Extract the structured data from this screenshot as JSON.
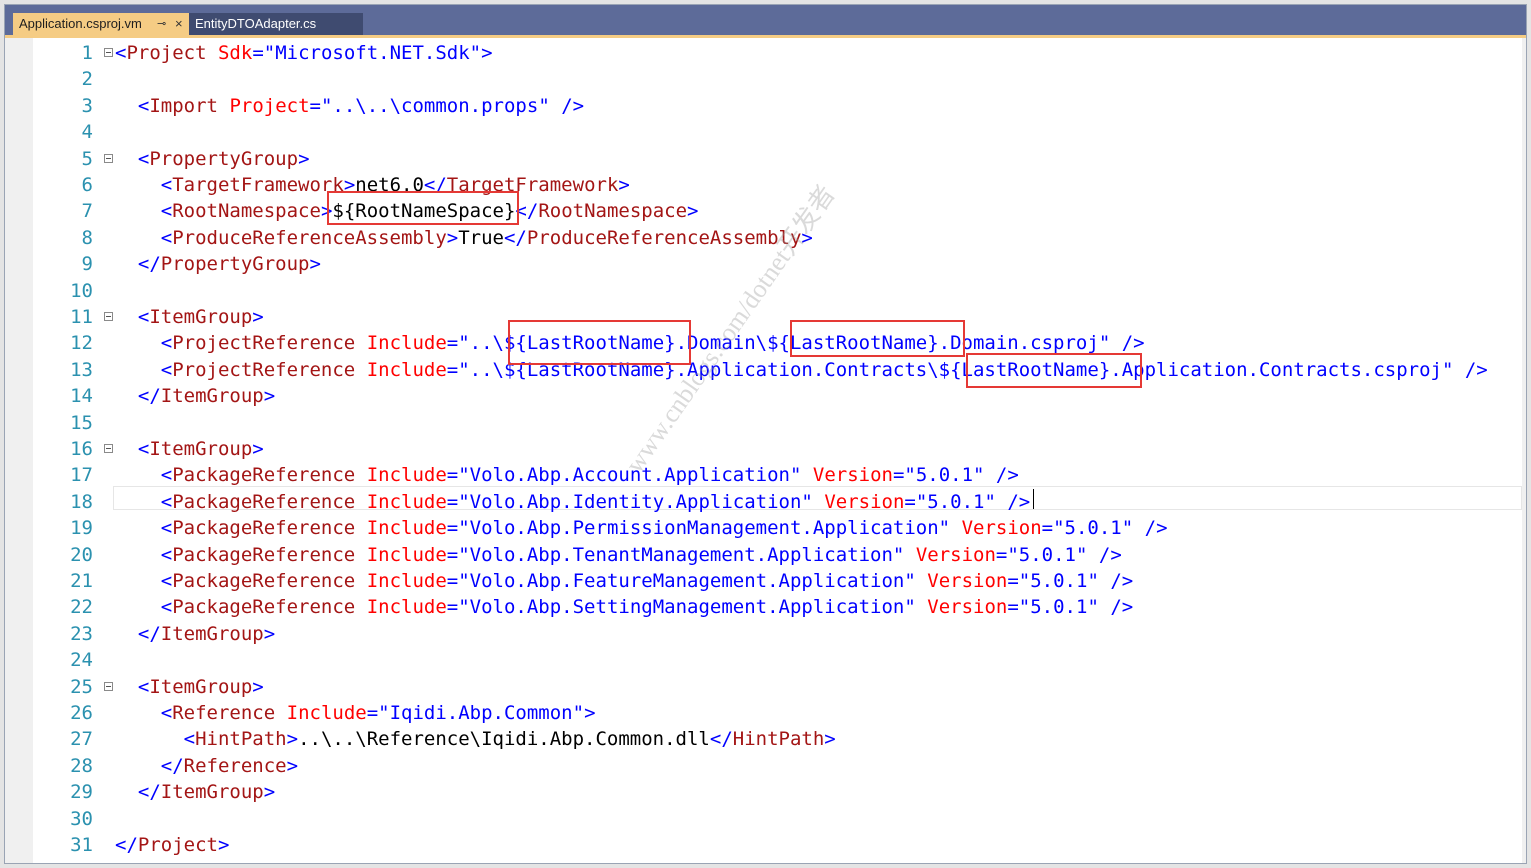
{
  "tabs": [
    {
      "label": "Application.csproj.vm",
      "pin": "⊸",
      "close": "×",
      "active": true
    },
    {
      "label": "EntityDTOAdapter.cs",
      "active": false
    }
  ],
  "watermark": "www.cnblogs.com/dotnet开发者",
  "lines": [
    {
      "n": "1",
      "fold": true,
      "s": [
        [
          "t",
          "<"
        ],
        [
          "e",
          "Project"
        ],
        [
          "x",
          " "
        ],
        [
          "a",
          "Sdk"
        ],
        [
          "t",
          "=\""
        ],
        [
          "v",
          "Microsoft.NET.Sdk"
        ],
        [
          "t",
          "\">"
        ]
      ]
    },
    {
      "n": "2",
      "s": []
    },
    {
      "n": "3",
      "s": [
        [
          "x",
          "  "
        ],
        [
          "t",
          "<"
        ],
        [
          "e",
          "Import"
        ],
        [
          "x",
          " "
        ],
        [
          "a",
          "Project"
        ],
        [
          "t",
          "=\""
        ],
        [
          "v",
          "..\\..\\common.props"
        ],
        [
          "t",
          "\" />"
        ]
      ]
    },
    {
      "n": "4",
      "s": []
    },
    {
      "n": "5",
      "fold": true,
      "s": [
        [
          "x",
          "  "
        ],
        [
          "t",
          "<"
        ],
        [
          "e",
          "PropertyGroup"
        ],
        [
          "t",
          ">"
        ]
      ]
    },
    {
      "n": "6",
      "s": [
        [
          "x",
          "    "
        ],
        [
          "t",
          "<"
        ],
        [
          "e",
          "TargetFramework"
        ],
        [
          "t",
          ">"
        ],
        [
          "x",
          "net6.0"
        ],
        [
          "t",
          "</"
        ],
        [
          "e",
          "TargetFramework"
        ],
        [
          "t",
          ">"
        ]
      ]
    },
    {
      "n": "7",
      "s": [
        [
          "x",
          "    "
        ],
        [
          "t",
          "<"
        ],
        [
          "e",
          "RootNamespace"
        ],
        [
          "t",
          ">"
        ],
        [
          "x",
          "${RootNameSpace}"
        ],
        [
          "t",
          "</"
        ],
        [
          "e",
          "RootNamespace"
        ],
        [
          "t",
          ">"
        ]
      ]
    },
    {
      "n": "8",
      "s": [
        [
          "x",
          "    "
        ],
        [
          "t",
          "<"
        ],
        [
          "e",
          "ProduceReferenceAssembly"
        ],
        [
          "t",
          ">"
        ],
        [
          "x",
          "True"
        ],
        [
          "t",
          "</"
        ],
        [
          "e",
          "ProduceReferenceAssembly"
        ],
        [
          "t",
          ">"
        ]
      ]
    },
    {
      "n": "9",
      "s": [
        [
          "x",
          "  "
        ],
        [
          "t",
          "</"
        ],
        [
          "e",
          "PropertyGroup"
        ],
        [
          "t",
          ">"
        ]
      ]
    },
    {
      "n": "10",
      "s": []
    },
    {
      "n": "11",
      "fold": true,
      "s": [
        [
          "x",
          "  "
        ],
        [
          "t",
          "<"
        ],
        [
          "e",
          "ItemGroup"
        ],
        [
          "t",
          ">"
        ]
      ]
    },
    {
      "n": "12",
      "s": [
        [
          "x",
          "    "
        ],
        [
          "t",
          "<"
        ],
        [
          "e",
          "ProjectReference"
        ],
        [
          "x",
          " "
        ],
        [
          "a",
          "Include"
        ],
        [
          "t",
          "=\""
        ],
        [
          "v",
          "..\\${LastRootName}.Domain\\${LastRootName}.Domain.csproj"
        ],
        [
          "t",
          "\" />"
        ]
      ]
    },
    {
      "n": "13",
      "s": [
        [
          "x",
          "    "
        ],
        [
          "t",
          "<"
        ],
        [
          "e",
          "ProjectReference"
        ],
        [
          "x",
          " "
        ],
        [
          "a",
          "Include"
        ],
        [
          "t",
          "=\""
        ],
        [
          "v",
          "..\\${LastRootName}.Application.Contracts\\${LastRootName}.Application.Contracts.csproj"
        ],
        [
          "t",
          "\" />"
        ]
      ]
    },
    {
      "n": "14",
      "s": [
        [
          "x",
          "  "
        ],
        [
          "t",
          "</"
        ],
        [
          "e",
          "ItemGroup"
        ],
        [
          "t",
          ">"
        ]
      ]
    },
    {
      "n": "15",
      "s": []
    },
    {
      "n": "16",
      "fold": true,
      "s": [
        [
          "x",
          "  "
        ],
        [
          "t",
          "<"
        ],
        [
          "e",
          "ItemGroup"
        ],
        [
          "t",
          ">"
        ]
      ]
    },
    {
      "n": "17",
      "s": [
        [
          "x",
          "    "
        ],
        [
          "t",
          "<"
        ],
        [
          "e",
          "PackageReference"
        ],
        [
          "x",
          " "
        ],
        [
          "a",
          "Include"
        ],
        [
          "t",
          "=\""
        ],
        [
          "v",
          "Volo.Abp.Account.Application"
        ],
        [
          "t",
          "\""
        ],
        [
          "x",
          " "
        ],
        [
          "a",
          "Version"
        ],
        [
          "t",
          "=\""
        ],
        [
          "v",
          "5.0.1"
        ],
        [
          "t",
          "\" />"
        ]
      ]
    },
    {
      "n": "18",
      "s": [
        [
          "x",
          "    "
        ],
        [
          "t",
          "<"
        ],
        [
          "e",
          "PackageReference"
        ],
        [
          "x",
          " "
        ],
        [
          "a",
          "Include"
        ],
        [
          "t",
          "=\""
        ],
        [
          "v",
          "Volo.Abp.Identity.Application"
        ],
        [
          "t",
          "\""
        ],
        [
          "x",
          " "
        ],
        [
          "a",
          "Version"
        ],
        [
          "t",
          "=\""
        ],
        [
          "v",
          "5.0.1"
        ],
        [
          "t",
          "\" />"
        ]
      ]
    },
    {
      "n": "19",
      "s": [
        [
          "x",
          "    "
        ],
        [
          "t",
          "<"
        ],
        [
          "e",
          "PackageReference"
        ],
        [
          "x",
          " "
        ],
        [
          "a",
          "Include"
        ],
        [
          "t",
          "=\""
        ],
        [
          "v",
          "Volo.Abp.PermissionManagement.Application"
        ],
        [
          "t",
          "\""
        ],
        [
          "x",
          " "
        ],
        [
          "a",
          "Version"
        ],
        [
          "t",
          "=\""
        ],
        [
          "v",
          "5.0.1"
        ],
        [
          "t",
          "\" />"
        ]
      ]
    },
    {
      "n": "20",
      "s": [
        [
          "x",
          "    "
        ],
        [
          "t",
          "<"
        ],
        [
          "e",
          "PackageReference"
        ],
        [
          "x",
          " "
        ],
        [
          "a",
          "Include"
        ],
        [
          "t",
          "=\""
        ],
        [
          "v",
          "Volo.Abp.TenantManagement.Application"
        ],
        [
          "t",
          "\""
        ],
        [
          "x",
          " "
        ],
        [
          "a",
          "Version"
        ],
        [
          "t",
          "=\""
        ],
        [
          "v",
          "5.0.1"
        ],
        [
          "t",
          "\" />"
        ]
      ]
    },
    {
      "n": "21",
      "s": [
        [
          "x",
          "    "
        ],
        [
          "t",
          "<"
        ],
        [
          "e",
          "PackageReference"
        ],
        [
          "x",
          " "
        ],
        [
          "a",
          "Include"
        ],
        [
          "t",
          "=\""
        ],
        [
          "v",
          "Volo.Abp.FeatureManagement.Application"
        ],
        [
          "t",
          "\""
        ],
        [
          "x",
          " "
        ],
        [
          "a",
          "Version"
        ],
        [
          "t",
          "=\""
        ],
        [
          "v",
          "5.0.1"
        ],
        [
          "t",
          "\" />"
        ]
      ]
    },
    {
      "n": "22",
      "s": [
        [
          "x",
          "    "
        ],
        [
          "t",
          "<"
        ],
        [
          "e",
          "PackageReference"
        ],
        [
          "x",
          " "
        ],
        [
          "a",
          "Include"
        ],
        [
          "t",
          "=\""
        ],
        [
          "v",
          "Volo.Abp.SettingManagement.Application"
        ],
        [
          "t",
          "\""
        ],
        [
          "x",
          " "
        ],
        [
          "a",
          "Version"
        ],
        [
          "t",
          "=\""
        ],
        [
          "v",
          "5.0.1"
        ],
        [
          "t",
          "\" />"
        ]
      ]
    },
    {
      "n": "23",
      "s": [
        [
          "x",
          "  "
        ],
        [
          "t",
          "</"
        ],
        [
          "e",
          "ItemGroup"
        ],
        [
          "t",
          ">"
        ]
      ]
    },
    {
      "n": "24",
      "s": []
    },
    {
      "n": "25",
      "fold": true,
      "s": [
        [
          "x",
          "  "
        ],
        [
          "t",
          "<"
        ],
        [
          "e",
          "ItemGroup"
        ],
        [
          "t",
          ">"
        ]
      ]
    },
    {
      "n": "26",
      "s": [
        [
          "x",
          "    "
        ],
        [
          "t",
          "<"
        ],
        [
          "e",
          "Reference"
        ],
        [
          "x",
          " "
        ],
        [
          "a",
          "Include"
        ],
        [
          "t",
          "=\""
        ],
        [
          "v",
          "Iqidi.Abp.Common"
        ],
        [
          "t",
          "\">"
        ]
      ]
    },
    {
      "n": "27",
      "s": [
        [
          "x",
          "      "
        ],
        [
          "t",
          "<"
        ],
        [
          "e",
          "HintPath"
        ],
        [
          "t",
          ">"
        ],
        [
          "x",
          "..\\..\\Reference\\Iqidi.Abp.Common.dll"
        ],
        [
          "t",
          "</"
        ],
        [
          "e",
          "HintPath"
        ],
        [
          "t",
          ">"
        ]
      ]
    },
    {
      "n": "28",
      "s": [
        [
          "x",
          "    "
        ],
        [
          "t",
          "</"
        ],
        [
          "e",
          "Reference"
        ],
        [
          "t",
          ">"
        ]
      ]
    },
    {
      "n": "29",
      "s": [
        [
          "x",
          "  "
        ],
        [
          "t",
          "</"
        ],
        [
          "e",
          "ItemGroup"
        ],
        [
          "t",
          ">"
        ]
      ]
    },
    {
      "n": "30",
      "s": []
    },
    {
      "n": "31",
      "s": [
        [
          "t",
          "</"
        ],
        [
          "e",
          "Project"
        ],
        [
          "t",
          ">"
        ]
      ]
    }
  ]
}
